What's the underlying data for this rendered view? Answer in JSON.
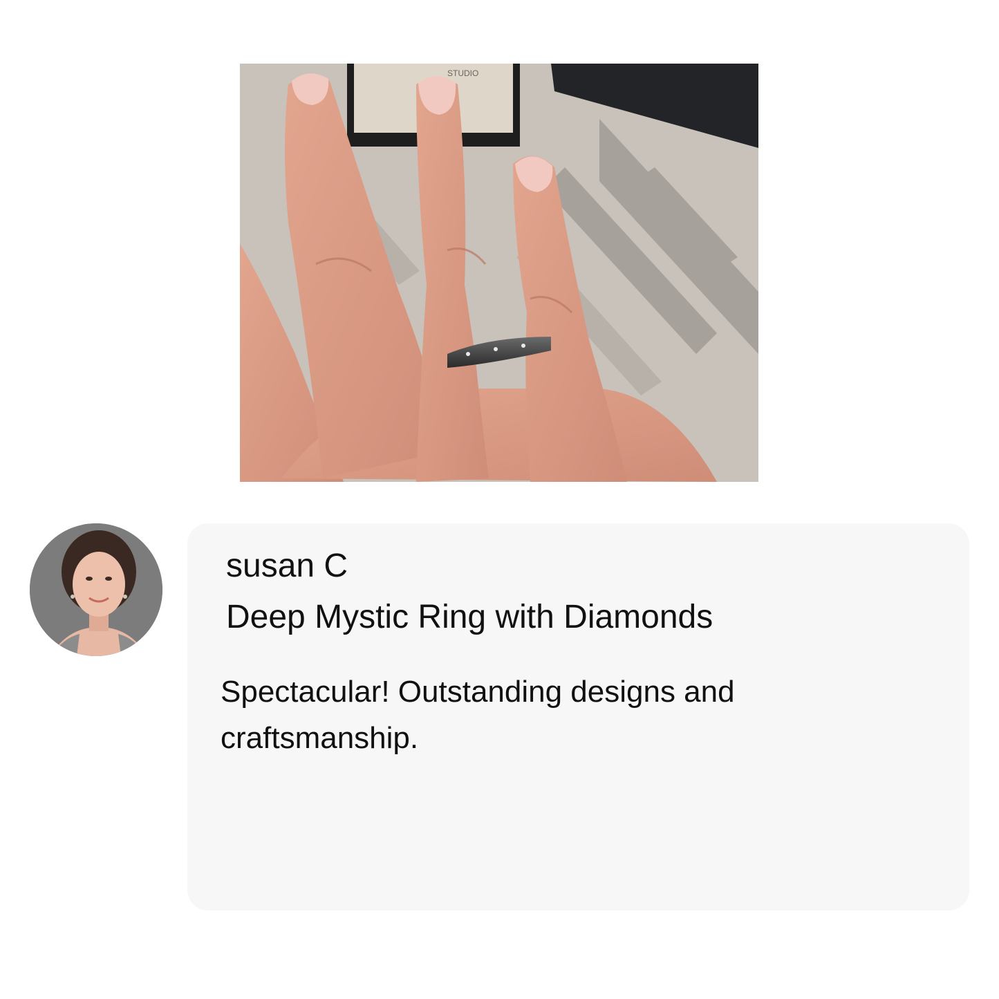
{
  "photo": {
    "box_label": "STUDIO",
    "description_icon": "ring-on-hand-photo"
  },
  "avatar": {
    "icon": "reviewer-portrait"
  },
  "review": {
    "reviewer_name": "susan C",
    "product_title": "Deep Mystic Ring with Diamonds",
    "body": "Spectacular! Outstanding designs and craftsmanship."
  },
  "colors": {
    "card_background": "#f7f7f7",
    "page_background": "#ffffff",
    "text": "#111111"
  }
}
